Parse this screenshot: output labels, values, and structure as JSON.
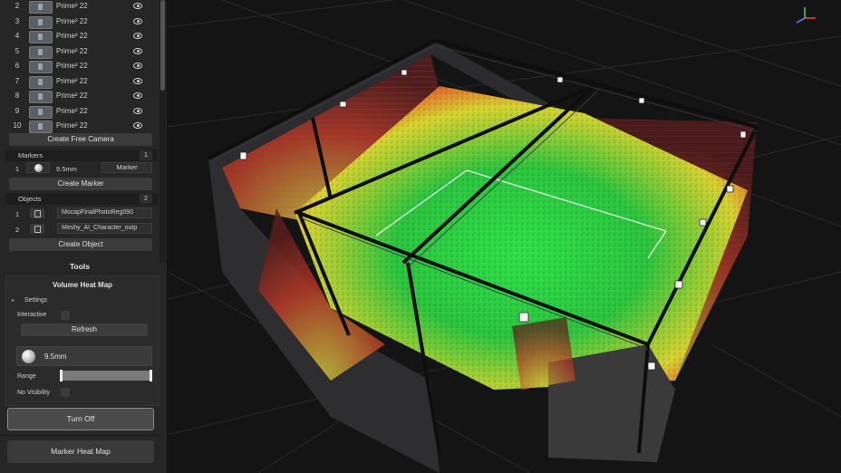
{
  "cameras": {
    "rows": [
      {
        "num": "2",
        "name": "Prime² 22"
      },
      {
        "num": "3",
        "name": "Prime² 22"
      },
      {
        "num": "4",
        "name": "Prime² 22"
      },
      {
        "num": "5",
        "name": "Prime² 22"
      },
      {
        "num": "6",
        "name": "Prime² 22"
      },
      {
        "num": "7",
        "name": "Prime² 22"
      },
      {
        "num": "8",
        "name": "Prime² 22"
      },
      {
        "num": "9",
        "name": "Prime² 22"
      },
      {
        "num": "10",
        "name": "Prime² 22"
      }
    ],
    "create_label": "Create Free Camera"
  },
  "markers": {
    "title": "Markers",
    "count": "1",
    "row": {
      "num": "1",
      "size": "9.5mm",
      "name": "Marker"
    },
    "create_label": "Create Marker"
  },
  "objects": {
    "title": "Objects",
    "count": "2",
    "rows": [
      {
        "num": "1",
        "name": "MocapFinalPhotoReg090"
      },
      {
        "num": "2",
        "name": "Meshy_AI_Character_outp"
      }
    ],
    "create_label": "Create Object"
  },
  "tools": {
    "title": "Tools",
    "volume_heat_map": {
      "title": "Volume Heat Map",
      "settings_label": "Settings",
      "interactive_label": "Interactive",
      "refresh_label": "Refresh",
      "size": "9.5mm",
      "range_label": "Range",
      "no_visibility_label": "No Visibility",
      "turn_off_label": "Turn Off"
    },
    "marker_heat_map_label": "Marker Heat Map"
  },
  "colors": {
    "heat_low": "#2ee04a",
    "heat_mid": "#d6d230",
    "heat_high": "#e0282a",
    "gizmo_x": "#e04040",
    "gizmo_y": "#40d040",
    "gizmo_z": "#4080ff"
  }
}
